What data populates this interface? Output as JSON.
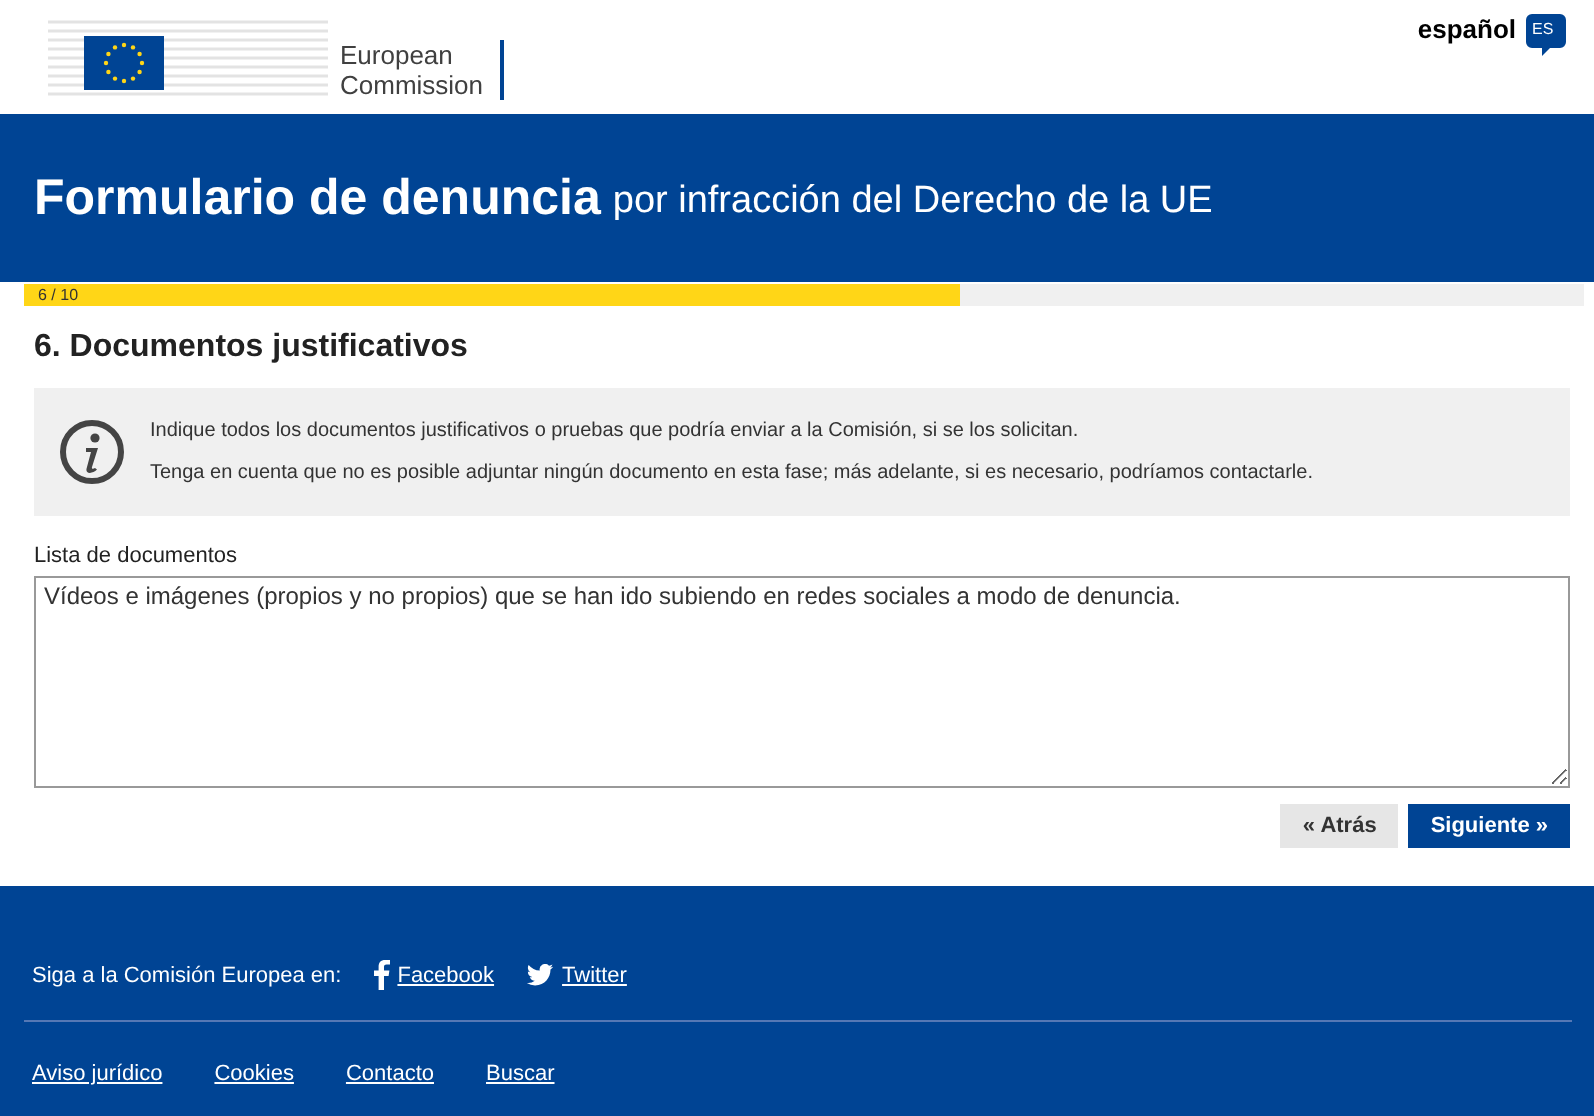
{
  "header": {
    "logo_text": [
      "European",
      "Commission"
    ],
    "language": {
      "label": "español",
      "code": "ES"
    }
  },
  "banner": {
    "title": "Formulario de denuncia",
    "subtitle": "por infracción del Derecho de la UE"
  },
  "progress": {
    "label": "6 / 10",
    "level": 0.6
  },
  "section": {
    "title": "6. Documentos justificativos",
    "info": [
      "Indique todos los documentos justificativos o pruebas que podría enviar a la Comisión, si se los solicitan.",
      "Tenga en cuenta que no es posible adjuntar ningún documento en esta fase; más adelante, si es necesario, podríamos contactarle."
    ],
    "field": {
      "label": "Lista de documentos",
      "value": "Vídeos e imágenes (propios y no propios) que se han ido subiendo en redes sociales a modo de denuncia."
    }
  },
  "buttons": [
    {
      "label": "« Atrás",
      "kind": "secondary"
    },
    {
      "label": "Siguiente »",
      "kind": "primary"
    }
  ],
  "footer": {
    "follow_text": "Siga a la Comisión Europea en:",
    "social": [
      {
        "label": "Facebook",
        "kind": "facebook"
      },
      {
        "label": "Twitter",
        "kind": "twitter"
      }
    ],
    "links": [
      "Aviso jurídico",
      "Cookies",
      "Contacto",
      "Buscar"
    ]
  }
}
